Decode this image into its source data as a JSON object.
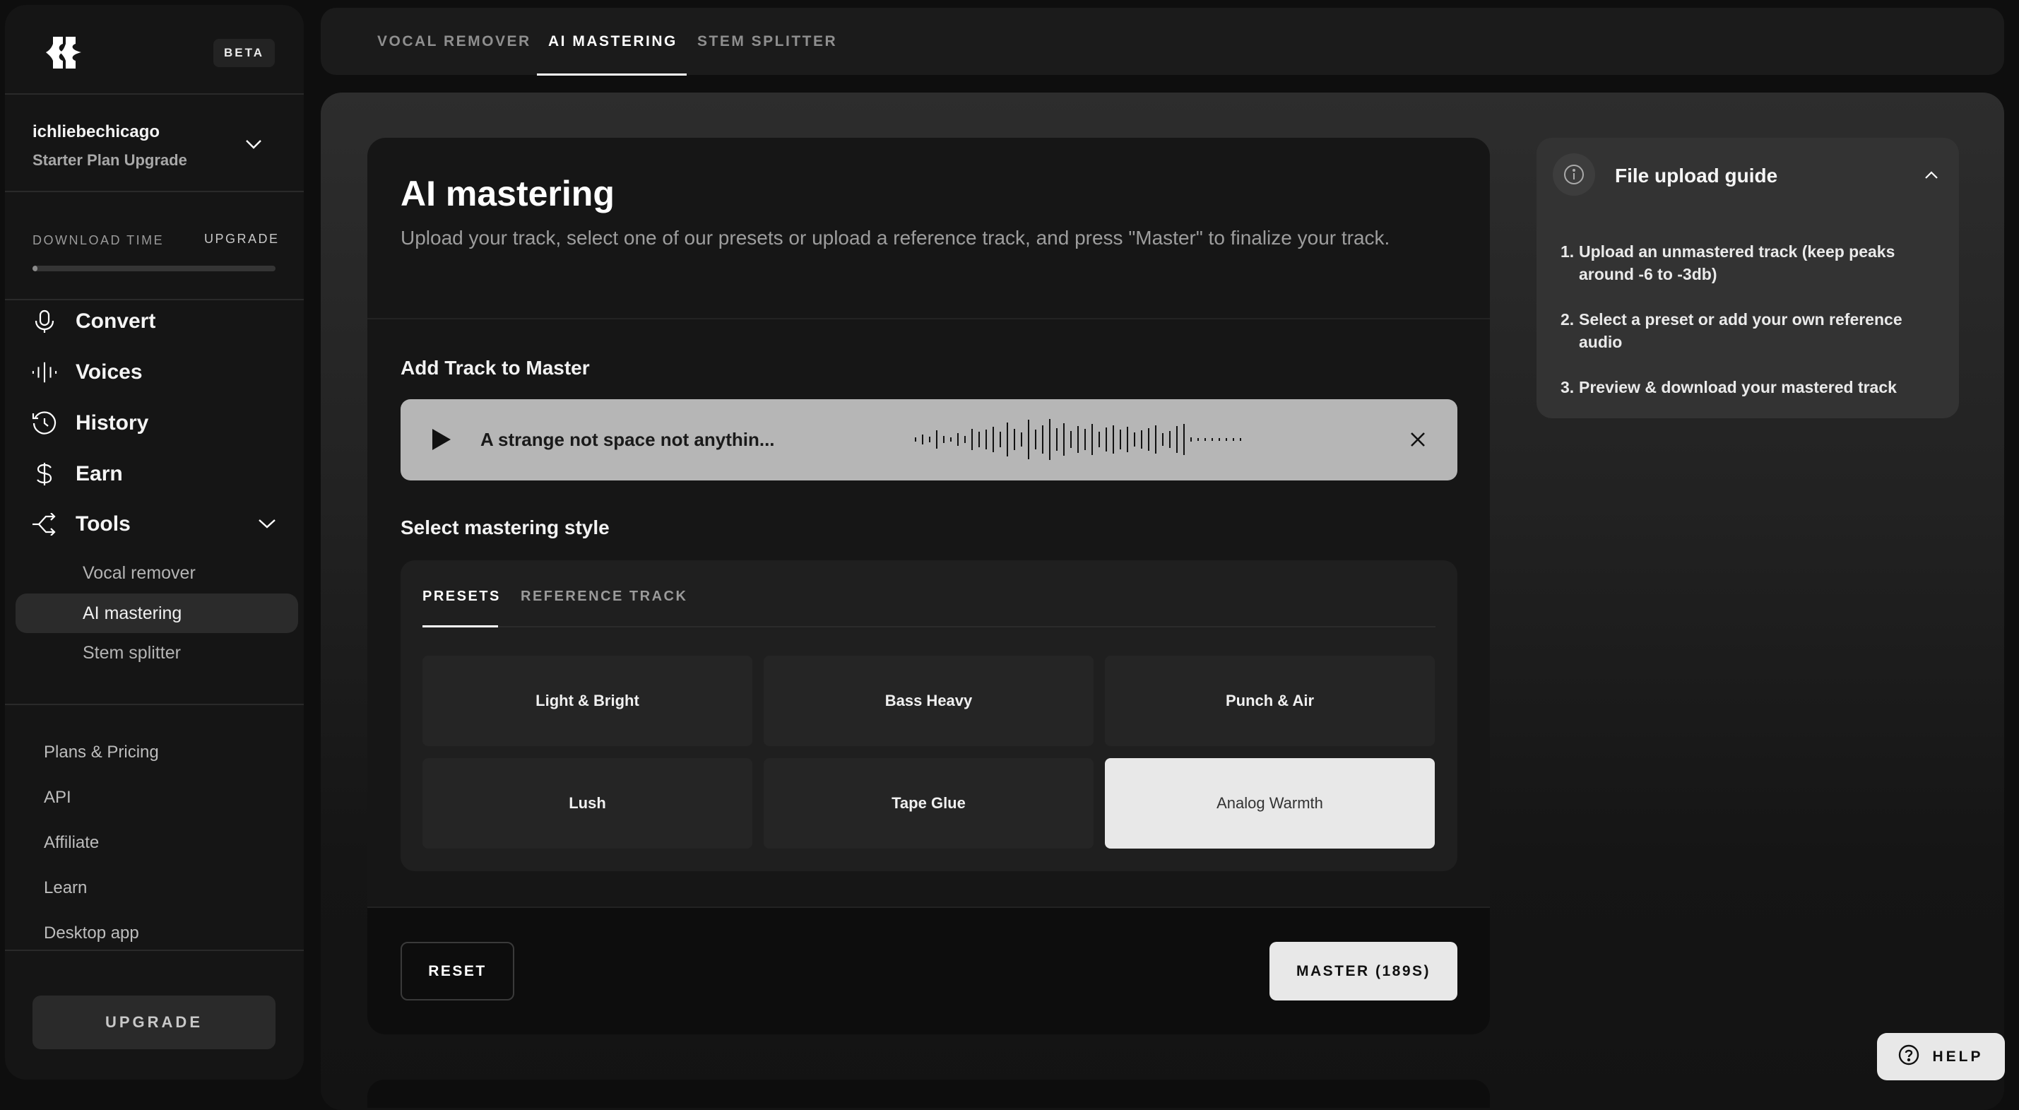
{
  "sidebar": {
    "beta_badge": "BETA",
    "user": {
      "name": "ichliebechicago",
      "plan": "Starter Plan Upgrade"
    },
    "download_time": {
      "label": "DOWNLOAD TIME",
      "upgrade_link": "UPGRADE",
      "progress_fraction": 0.02
    },
    "nav": [
      {
        "label": "Convert",
        "icon": "microphone-icon"
      },
      {
        "label": "Voices",
        "icon": "waveform-icon"
      },
      {
        "label": "History",
        "icon": "history-icon"
      },
      {
        "label": "Earn",
        "icon": "dollar-icon"
      },
      {
        "label": "Tools",
        "icon": "tools-icon",
        "expanded": true
      }
    ],
    "tools_sub": [
      {
        "label": "Vocal remover",
        "active": false
      },
      {
        "label": "AI mastering",
        "active": true
      },
      {
        "label": "Stem splitter",
        "active": false
      }
    ],
    "footer_links": [
      "Plans & Pricing",
      "API",
      "Affiliate",
      "Learn",
      "Desktop app"
    ],
    "upgrade_button": "UPGRADE"
  },
  "top_tabs": [
    {
      "label": "VOCAL REMOVER",
      "active": false
    },
    {
      "label": "AI MASTERING",
      "active": true
    },
    {
      "label": "STEM SPLITTER",
      "active": false
    }
  ],
  "card": {
    "title": "AI mastering",
    "description": "Upload your track, select one of our presets or upload a reference track, and press \"Master\" to finalize your track.",
    "add_track_label": "Add Track to Master",
    "track": {
      "name": "A strange not space not anythin..."
    },
    "style_label": "Select mastering style",
    "style_tabs": [
      {
        "label": "PRESETS",
        "active": true
      },
      {
        "label": "REFERENCE TRACK",
        "active": false
      }
    ],
    "presets": [
      {
        "label": "Light & Bright",
        "selected": false
      },
      {
        "label": "Bass Heavy",
        "selected": false
      },
      {
        "label": "Punch & Air",
        "selected": false
      },
      {
        "label": "Lush",
        "selected": false
      },
      {
        "label": "Tape Glue",
        "selected": false
      },
      {
        "label": "Analog Warmth",
        "selected": true
      }
    ],
    "reset_button": "RESET",
    "master_button": "MASTER (189S)"
  },
  "guide": {
    "title": "File upload guide",
    "steps": [
      "Upload an unmastered track (keep peaks around -6 to -3db)",
      "Select a preset or add your own reference audio",
      "Preview & download your mastered track"
    ]
  },
  "help_button": "HELP"
}
